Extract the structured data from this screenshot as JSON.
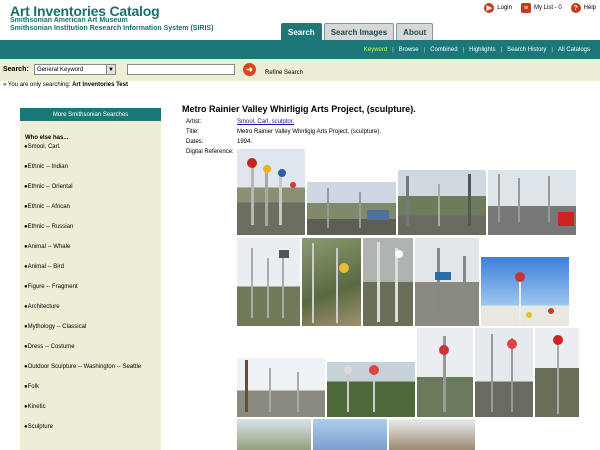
{
  "header": {
    "title": "Art Inventories Catalog",
    "subtitle1": "Smithsonian American Art Museum",
    "subtitle2": "Smithsonian Institution Research Information System (SIRIS)",
    "links": [
      {
        "label": "Login",
        "icon": "login-icon"
      },
      {
        "label": "My List - 0",
        "icon": "list-icon"
      },
      {
        "label": "Help",
        "icon": "help-icon"
      }
    ]
  },
  "tabs": [
    {
      "label": "Search",
      "active": true
    },
    {
      "label": "Search Images",
      "active": false
    },
    {
      "label": "About",
      "active": false
    }
  ],
  "nav": [
    {
      "label": "Keyword",
      "active": true
    },
    {
      "label": "Browse"
    },
    {
      "label": "Combined"
    },
    {
      "label": "Highlights"
    },
    {
      "label": "Search History"
    },
    {
      "label": "All Catalogs"
    }
  ],
  "search": {
    "label": "Search:",
    "select_value": "General Keyword",
    "input_value": "",
    "refine": "Refine Search",
    "searching_prefix": "» You are only searching: ",
    "searching_target": "Art Inventories Test"
  },
  "sidebar": {
    "heading": "More Smithsonian Searches",
    "who_label": "Who else has...",
    "items": [
      "●Smool, Carl.",
      "●Ethnic -- Indian",
      "●Ethnic -- Oriental",
      "●Ethnic -- African",
      "●Ethnic -- Russian",
      "●Animal -- Whale",
      "●Animal -- Bird",
      "●Figure -- Fragment",
      "●Architecture",
      "●Mythology -- Classical",
      "●Dress -- Costume",
      "●Outdoor Sculpture -- Washington -- Seattle",
      "●Folk",
      "●Kinetic",
      "●Sculpture"
    ]
  },
  "record": {
    "title": "Metro Rainier Valley Whirligig Arts Project, (sculpture).",
    "fields": [
      {
        "label": "Artist:",
        "value": "Smool, Carl, sculptor.",
        "link": true
      },
      {
        "label": "Title:",
        "value": "Metro Rainier Valley Whirligig Arts Project, (sculpture).",
        "link": false
      },
      {
        "label": "Dates:",
        "value": "1994.",
        "link": false
      },
      {
        "label": "Digital Reference:",
        "value": "",
        "link": false
      }
    ]
  },
  "colors": {
    "brand_teal": "#1c7878",
    "panel_beige": "#eeeed6",
    "accent_orange": "#d8461c",
    "nav_active": "#c9ff4a"
  }
}
